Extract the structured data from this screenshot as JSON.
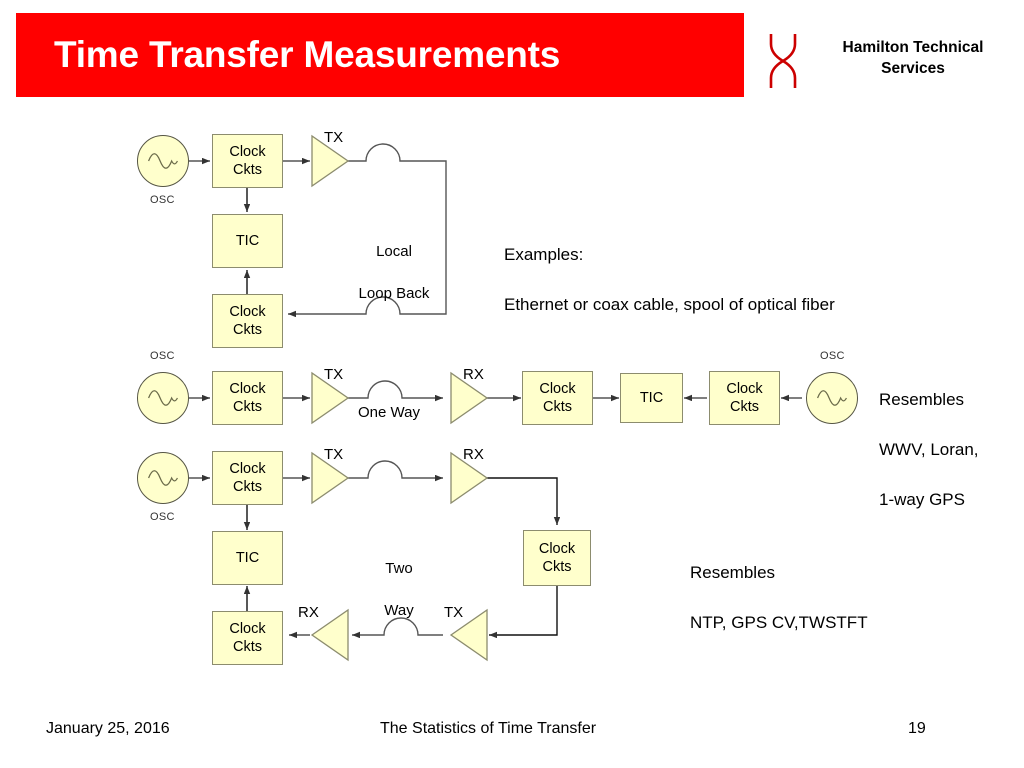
{
  "header": {
    "title": "Time Transfer Measurements",
    "banner_color": "#FF0000",
    "logo": {
      "name": "hamilton-technical-services-logo",
      "line1": "Hamilton Technical",
      "line2": "Services",
      "mark_color": "#CC0000"
    }
  },
  "diagram": {
    "box_fill": "#FFFFCC",
    "box_stroke": "#8C8C6E",
    "line_color": "#555555",
    "labels": {
      "clock_ckts": "Clock\nCkts",
      "clock_line1": "Clock",
      "clock_line2": "Ckts",
      "tic": "TIC",
      "tx": "TX",
      "rx": "RX",
      "osc": "OSC"
    },
    "row1": {
      "name": "local-loop-back-diagram",
      "path_label": "Local\nLoop Back",
      "path_label_line1": "Local",
      "path_label_line2": "Loop Back",
      "note": "Examples:\nEthernet or coax cable, spool of optical fiber",
      "note_line1": "Examples:",
      "note_line2": "Ethernet or coax cable, spool of optical fiber"
    },
    "row2": {
      "name": "one-way-diagram",
      "path_label": "One Way",
      "note_line1": "Resembles",
      "note_line2": "WWV, Loran,",
      "note_line3": "1-way GPS"
    },
    "row3": {
      "name": "two-way-diagram",
      "path_label_line1": "Two",
      "path_label_line2": "Way",
      "note_line1": "Resembles",
      "note_line2": "NTP, GPS CV,TWSTFT"
    }
  },
  "footer": {
    "date": "January 25, 2016",
    "title": "The Statistics of Time Transfer",
    "page": "19"
  }
}
